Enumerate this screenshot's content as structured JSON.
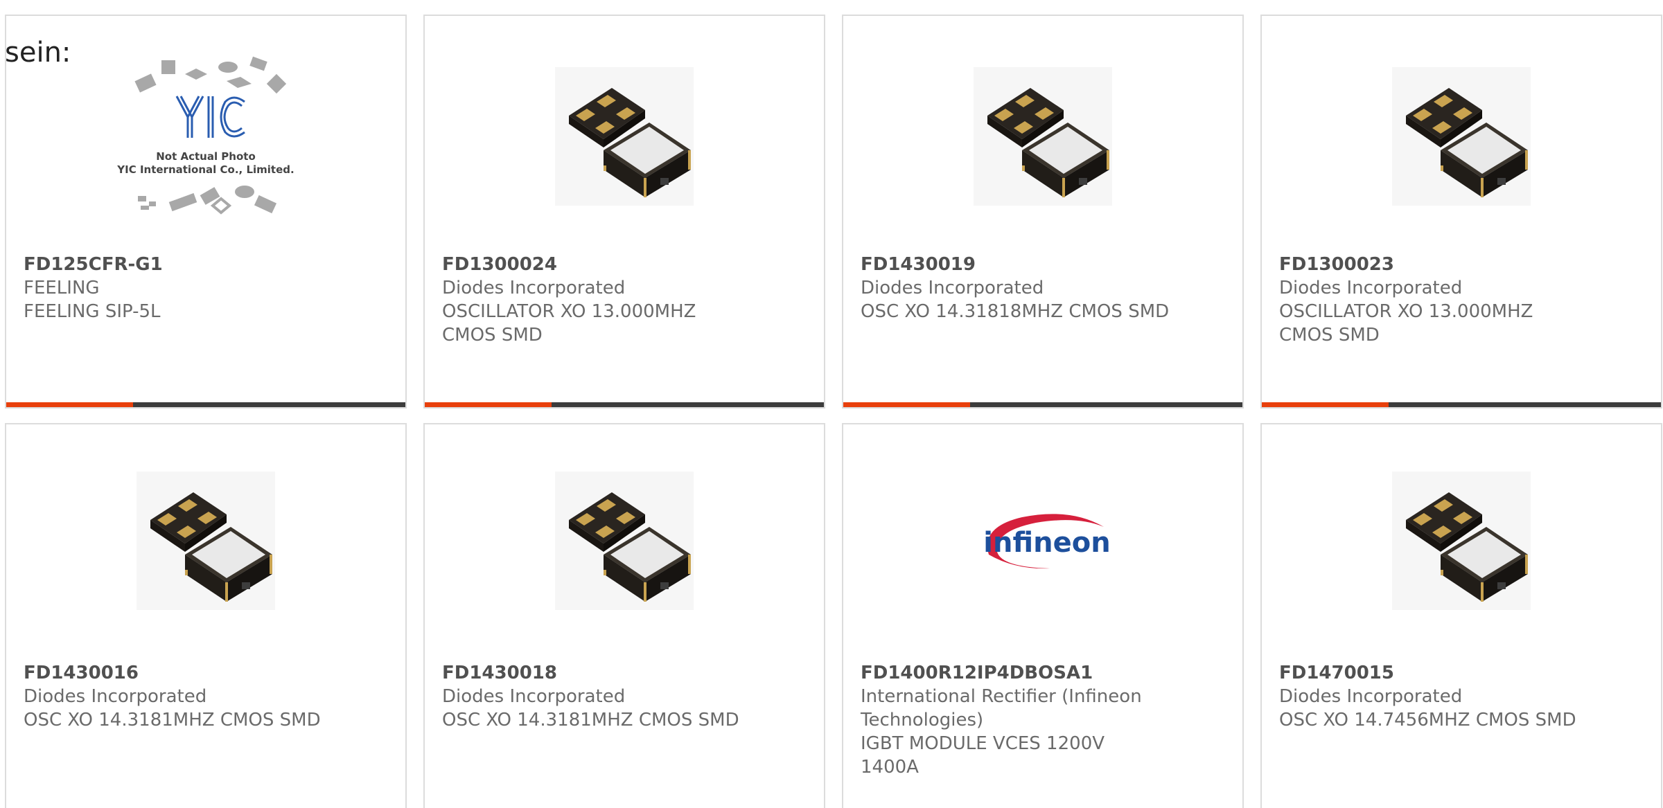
{
  "clipped_text": "sein:",
  "colors": {
    "accent": "#e8400c",
    "bar": "#3c3c3c",
    "border": "#dcdcdc",
    "text": "#6a6a6a"
  },
  "placeholder_image": {
    "logo": "YIC",
    "line1": "Not Actual Photo",
    "line2": "YIC International Co., Limited."
  },
  "logo_image_text": "infineon",
  "products": [
    {
      "part": "FD125CFR-G1",
      "maker": "FEELING",
      "desc_line1": "FEELING SIP-5L",
      "desc_line2": "",
      "desc_line3": "",
      "image": "yic-placeholder-image"
    },
    {
      "part": "FD1300024",
      "maker": "Diodes Incorporated",
      "desc_line1": "OSCILLATOR XO 13.000MHZ",
      "desc_line2": "CMOS SMD",
      "desc_line3": "",
      "image": "crystal-oscillator-image"
    },
    {
      "part": "FD1430019",
      "maker": "Diodes Incorporated",
      "desc_line1": "OSC XO 14.31818MHZ CMOS SMD",
      "desc_line2": "",
      "desc_line3": "",
      "image": "crystal-oscillator-image"
    },
    {
      "part": "FD1300023",
      "maker": "Diodes Incorporated",
      "desc_line1": "OSCILLATOR XO 13.000MHZ",
      "desc_line2": "CMOS SMD",
      "desc_line3": "",
      "image": "crystal-oscillator-image"
    },
    {
      "part": "FD1430016",
      "maker": "Diodes Incorporated",
      "desc_line1": "OSC XO 14.3181MHZ CMOS SMD",
      "desc_line2": "",
      "desc_line3": "",
      "image": "crystal-oscillator-image"
    },
    {
      "part": "FD1430018",
      "maker": "Diodes Incorporated",
      "desc_line1": "OSC XO 14.3181MHZ CMOS SMD",
      "desc_line2": "",
      "desc_line3": "",
      "image": "crystal-oscillator-image"
    },
    {
      "part": "FD1400R12IP4DBOSA1",
      "maker": "International Rectifier (Infineon",
      "desc_line1": "Technologies)",
      "desc_line2": "IGBT MODULE VCES 1200V",
      "desc_line3": "1400A",
      "image": "infineon-logo-image"
    },
    {
      "part": "FD1470015",
      "maker": "Diodes Incorporated",
      "desc_line1": "OSC XO 14.7456MHZ CMOS SMD",
      "desc_line2": "",
      "desc_line3": "",
      "image": "crystal-oscillator-image"
    }
  ]
}
